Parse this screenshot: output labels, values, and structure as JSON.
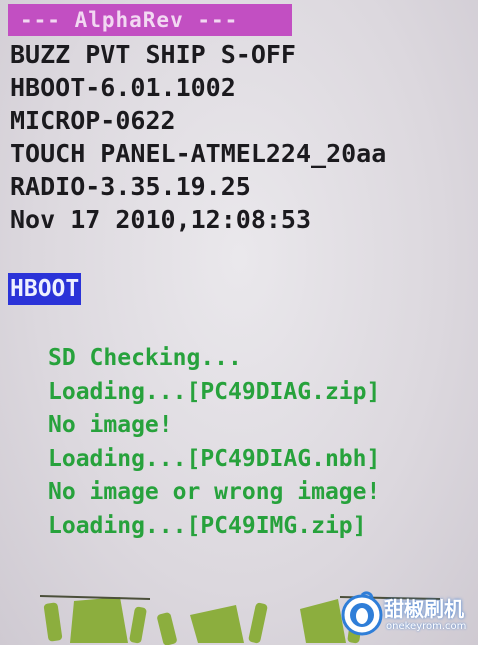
{
  "banner": {
    "title": "--- AlphaRev ---"
  },
  "device_info": [
    "BUZZ PVT SHIP S-OFF",
    "HBOOT-6.01.1002",
    "MICROP-0622",
    "TOUCH PANEL-ATMEL224_20aa",
    "RADIO-3.35.19.25",
    "Nov 17 2010,12:08:53"
  ],
  "menu": {
    "selected": "HBOOT"
  },
  "log": [
    "SD Checking...",
    "Loading...[PC49DIAG.zip]",
    "No image!",
    "Loading...[PC49DIAG.nbh]",
    "No image or wrong image!",
    "Loading...[PC49IMG.zip]"
  ],
  "watermark": {
    "brand": "甜椒刷机",
    "site": "onekeyrom.com",
    "icon": "pepper-logo-icon"
  },
  "colors": {
    "banner": "#c24fc2",
    "selection": "#2b33d8",
    "log_text": "#27a23c",
    "info_text": "#1b1a1e",
    "robot": "#8cae3e"
  },
  "icons": {
    "robots": "android-skateboard-icon"
  }
}
